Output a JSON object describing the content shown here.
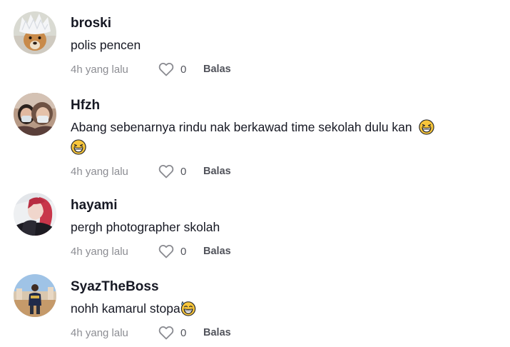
{
  "comments": [
    {
      "username": "broski",
      "text": "polis pencen",
      "time": "4h yang lalu",
      "likes": "0",
      "reply": "Balas",
      "avatar_icon": "dog-white-hair-avatar"
    },
    {
      "username": "Hfzh",
      "text_line1": "Abang sebenarnya rindu nak berkawad time sekolah dulu kan",
      "time": "4h yang lalu",
      "likes": "0",
      "reply": "Balas",
      "emoji": "grinning-squinting-face",
      "avatar_icon": "two-people-masks-avatar"
    },
    {
      "username": "hayami",
      "text": "pergh photographer skolah",
      "time": "4h yang lalu",
      "likes": "0",
      "reply": "Balas",
      "avatar_icon": "red-hair-anime-avatar"
    },
    {
      "username": "SyazTheBoss",
      "text": "nohh kamarul stopa",
      "time": "4h yang lalu",
      "likes": "0",
      "reply": "Balas",
      "emoji": "grinning-face-with-sweat",
      "avatar_icon": "person-outdoor-avatar"
    }
  ],
  "colors": {
    "text_primary": "#161823",
    "text_secondary": "#8a8b91",
    "background": "#ffffff"
  }
}
